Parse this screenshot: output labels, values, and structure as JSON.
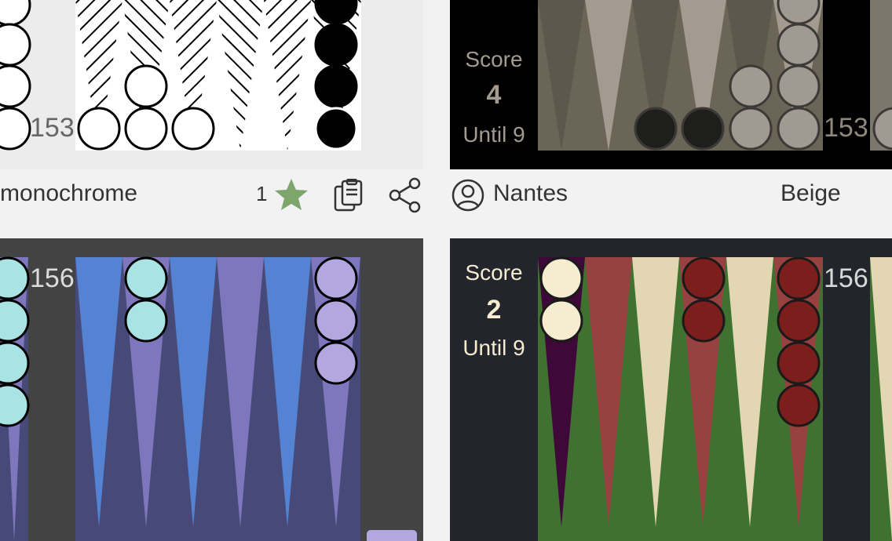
{
  "cards": [
    {
      "id": "monochrome",
      "name": "monochrome",
      "favorites_count": "1",
      "pip_count": "153",
      "colors": {
        "board": "#ececec",
        "bar": "#ececec",
        "checker_a": "#ffffff",
        "checker_b": "#000000",
        "stroke": "#000000"
      }
    },
    {
      "id": "beige",
      "name": "Beige",
      "author": "Nantes",
      "score_label": "Score",
      "score_value": "4",
      "until_label": "Until 9",
      "pip_count": "153",
      "colors": {
        "frame": "#000000",
        "board": "#6b6558",
        "point_light": "#a39b90",
        "point_dark": "#5d574c",
        "checker_light": "#a19a92",
        "checker_dark": "#1e1e1c"
      }
    },
    {
      "id": "blue-purple",
      "pip_count": "156",
      "colors": {
        "frame": "#434343",
        "board": "#474a78",
        "point_blue": "#5583d4",
        "point_purple": "#7f77bd",
        "checker_teal": "#a9e3e3",
        "checker_lavender": "#b3a7df"
      }
    },
    {
      "id": "green-red",
      "score_label": "Score",
      "score_value": "2",
      "until_label": "Until 9",
      "pip_count": "156",
      "colors": {
        "frame": "#23252d",
        "board": "#3f7230",
        "point_red": "#974241",
        "point_cream": "#e2d7b2",
        "checker_cream": "#f6ecd0",
        "checker_red": "#7c1f1c",
        "last_point": "#3e0838"
      }
    }
  ],
  "icons": {
    "favorite": "star-icon",
    "copy": "clipboard-icon",
    "share": "share-icon",
    "author": "user-circle-icon"
  }
}
